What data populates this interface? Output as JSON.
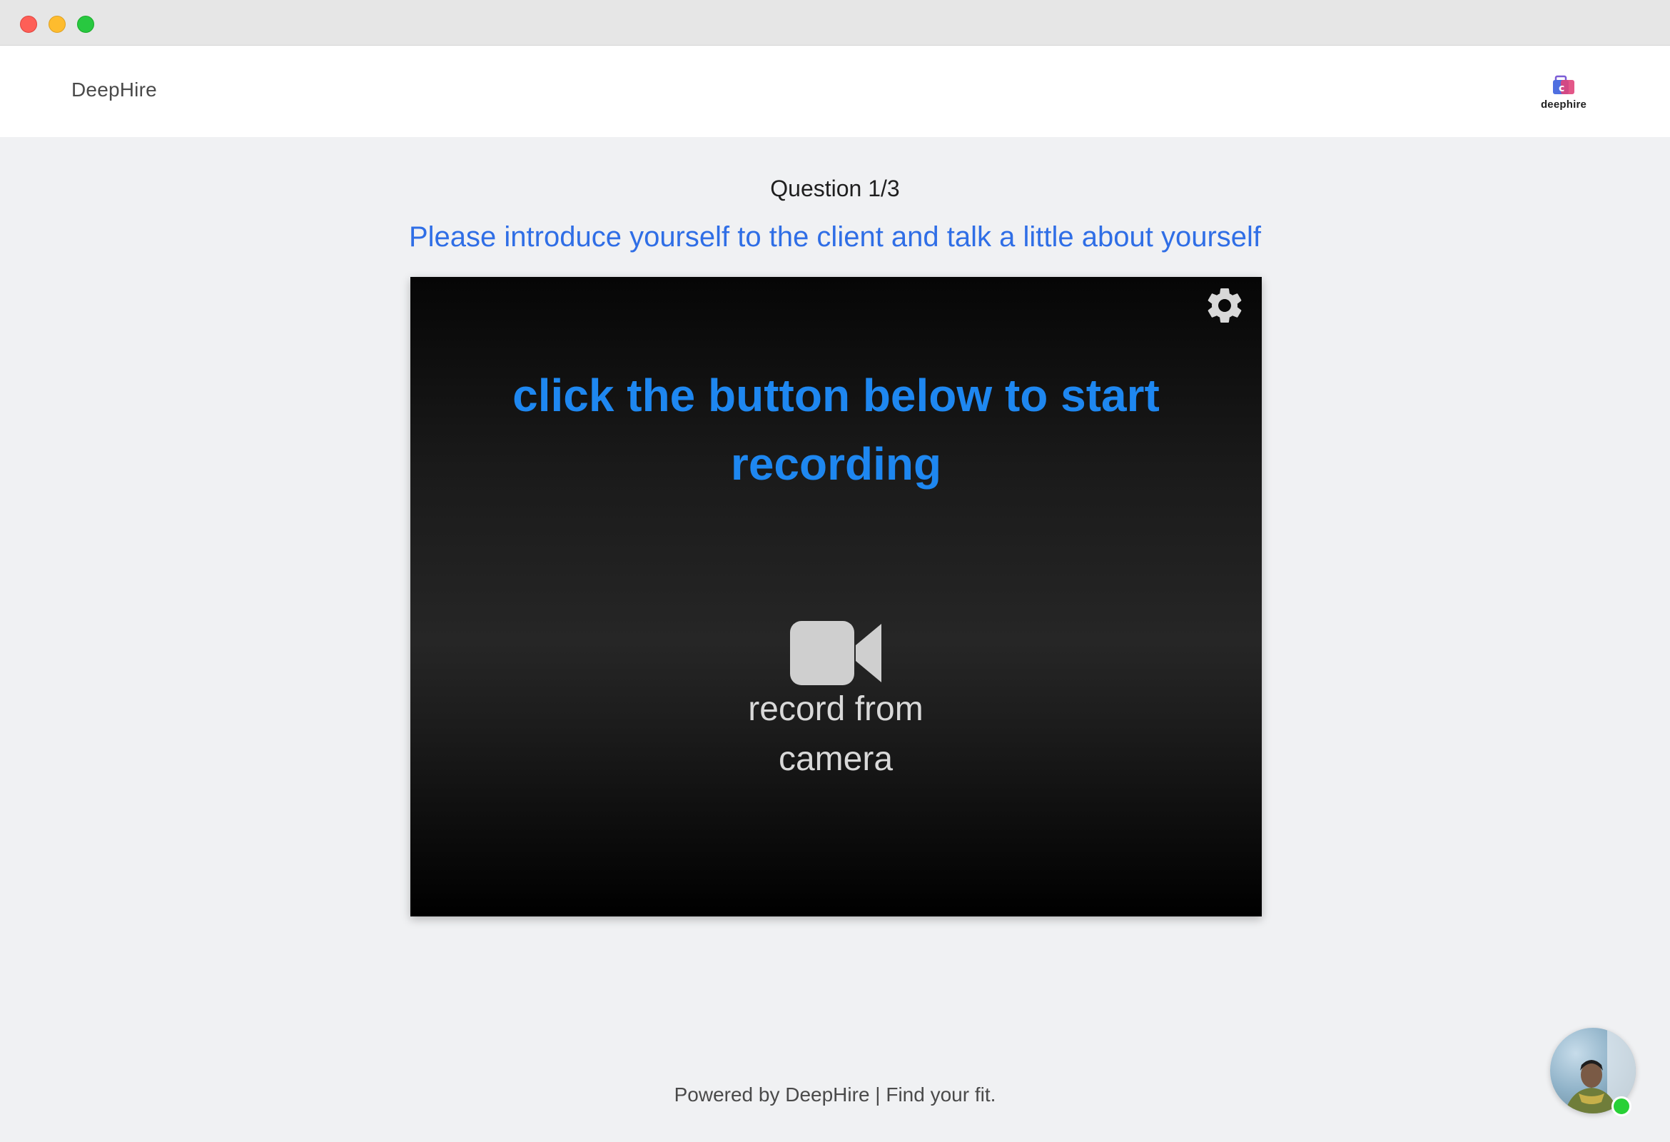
{
  "app": {
    "brand": "DeepHire",
    "logo_text": "deephire"
  },
  "question": {
    "number": "Question 1/3",
    "text": "Please introduce yourself to the client and talk a little about yourself"
  },
  "recorder": {
    "instruction": "click the button below to start recording",
    "record_label_line1": "record from",
    "record_label_line2": "camera",
    "settings_icon": "gear-icon",
    "record_icon": "video-camera-icon",
    "accent_color": "#1e87f0"
  },
  "footer": {
    "text": "Powered by DeepHire | Find your fit."
  },
  "chat_widget": {
    "status": "online",
    "status_color": "#28d036"
  }
}
